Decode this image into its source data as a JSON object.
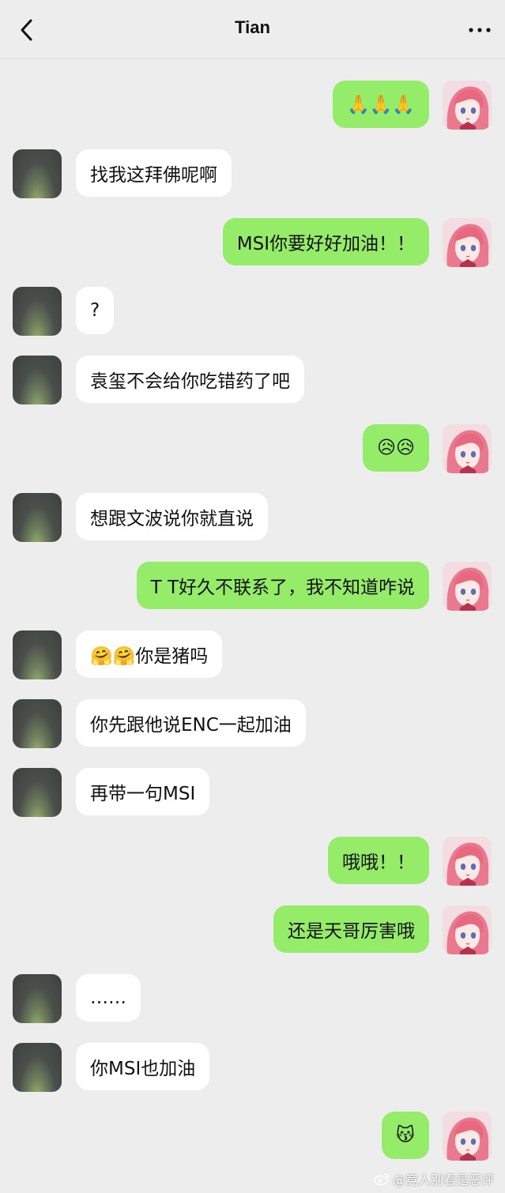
{
  "header": {
    "title": "Tian"
  },
  "messages": [
    {
      "side": "right",
      "text": "🙏🙏🙏"
    },
    {
      "side": "left",
      "text": "找我这拜佛呢啊"
    },
    {
      "side": "right",
      "text": "MSI你要好好加油！！"
    },
    {
      "side": "left",
      "text": "?"
    },
    {
      "side": "left",
      "text": "袁玺不会给你吃错药了吧"
    },
    {
      "side": "right",
      "text": "😥😥"
    },
    {
      "side": "left",
      "text": "想跟文波说你就直说"
    },
    {
      "side": "right",
      "text": "T T好久不联系了，我不知道咋说"
    },
    {
      "side": "left",
      "text": "🤗🤗你是猪吗"
    },
    {
      "side": "left",
      "text": "你先跟他说ENC一起加油"
    },
    {
      "side": "left",
      "text": "再带一句MSI"
    },
    {
      "side": "right",
      "text": "哦哦！！"
    },
    {
      "side": "right",
      "text": "还是天哥厉害哦"
    },
    {
      "side": "left",
      "text": "……"
    },
    {
      "side": "left",
      "text": "你MSI也加油"
    },
    {
      "side": "right",
      "text": "😽"
    }
  ],
  "watermark": {
    "text": "@竞人别看是恶评"
  },
  "colors": {
    "background": "#ededed",
    "bubble_self": "#95ec69",
    "bubble_other": "#ffffff"
  }
}
